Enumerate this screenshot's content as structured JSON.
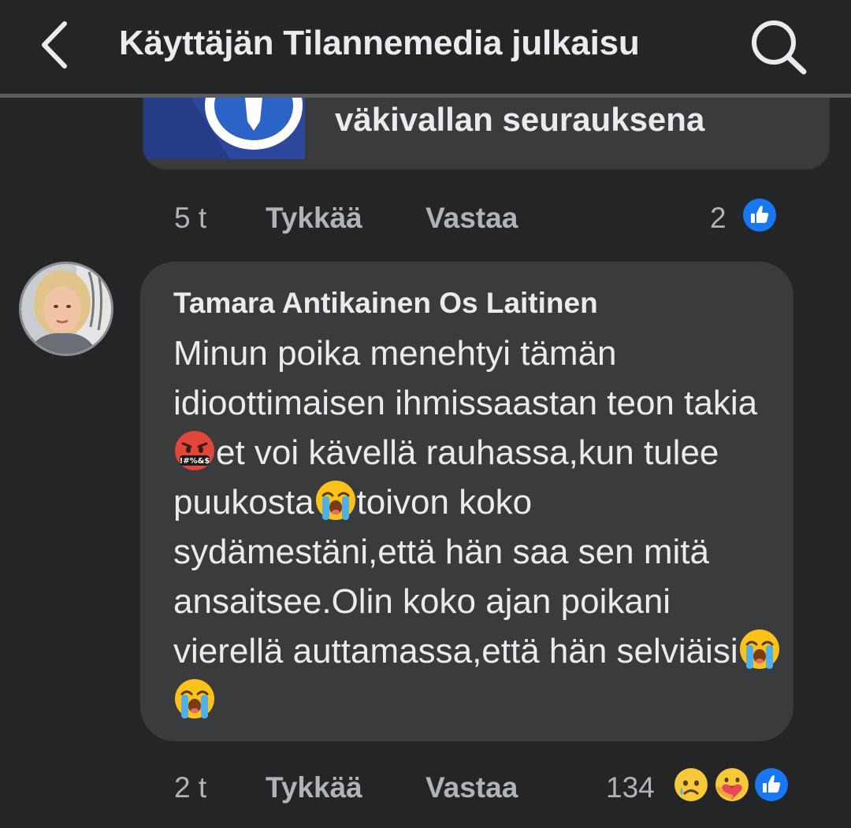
{
  "header": {
    "title": "Käyttäjän Tilannemedia julkaisu",
    "back_icon": "chevron-left-icon",
    "search_icon": "search-icon"
  },
  "preview": {
    "title": "väkivallan seurauksena"
  },
  "prev_comment_actions": {
    "time": "5 t",
    "like_label": "Tykkää",
    "reply_label": "Vastaa",
    "reaction_count": "2",
    "reactions": [
      "like-icon"
    ]
  },
  "comment": {
    "author": "Tamara Antikainen Os Laitinen",
    "segments": [
      "Minun poika menehtyi tämän idioottimaisen ihmissaastan teon takia",
      "et voi kävellä rauhassa,kun tulee puukosta",
      "toivon koko sydämestäni,että hän saa sen mitä ansaitsee.Olin koko ajan poikani vierellä auttamassa,että hän selviäisi"
    ],
    "emojis": [
      "face-with-symbols-icon",
      "loudly-crying-face-icon",
      "loudly-crying-face-icon",
      "loudly-crying-face-icon"
    ]
  },
  "comment_actions": {
    "time": "2 t",
    "like_label": "Tykkää",
    "reply_label": "Vastaa",
    "reaction_count": "134",
    "reactions": [
      "sad-icon",
      "care-icon",
      "like-icon"
    ]
  },
  "colors": {
    "background": "#242526",
    "bubble": "#3a3b3c",
    "secondary_text": "#b0b3b8",
    "like_blue": "#1877f2"
  }
}
